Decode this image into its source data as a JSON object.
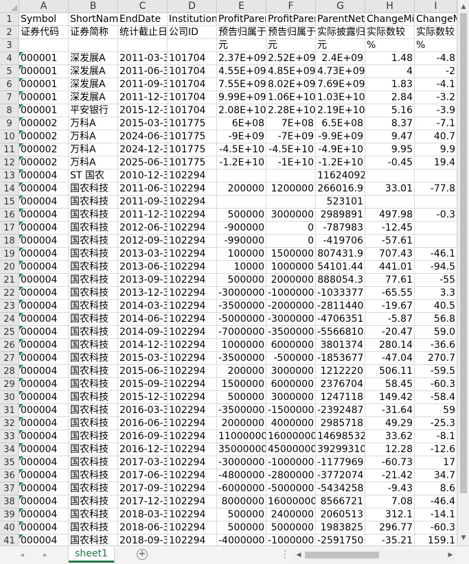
{
  "spreadsheet": {
    "columns": [
      "A",
      "B",
      "C",
      "D",
      "E",
      "F",
      "G",
      "H",
      "I"
    ],
    "column_width_names": [
      "A",
      "B",
      "C",
      "D",
      "E",
      "F",
      "G",
      "H",
      "I"
    ],
    "header_rows": [
      {
        "row": "1",
        "cells": [
          "Symbol",
          "ShortName",
          "EndDate",
          "InstitutionID",
          "ProfitParent",
          "ProfitParent",
          "ParentNetProfit",
          "ChangeMin",
          "ChangeMax"
        ]
      },
      {
        "row": "2",
        "cells": [
          "证券代码",
          "证券简称",
          "统计截止日期",
          "公司ID",
          "预告归属于",
          "预告归属于",
          "实际披露归",
          "实际数较",
          "实际数较"
        ]
      },
      {
        "row": "3",
        "cells": [
          "",
          "",
          "",
          "",
          "元",
          "元",
          "元",
          "%",
          "%"
        ]
      }
    ],
    "data_rows": [
      {
        "row": "4",
        "cells": [
          "000001",
          "深发展A",
          "2011-03-31",
          "101704",
          "2.37E+09",
          "2.52E+09",
          "2.4E+09",
          "1.48",
          "-4.8"
        ]
      },
      {
        "row": "5",
        "cells": [
          "000001",
          "深发展A",
          "2011-06-30",
          "101704",
          "4.55E+09",
          "4.85E+09",
          "4.73E+09",
          "4",
          "-2"
        ]
      },
      {
        "row": "6",
        "cells": [
          "000001",
          "深发展A",
          "2011-09-30",
          "101704",
          "7.55E+09",
          "8.02E+09",
          "7.69E+09",
          "1.83",
          "-4.1"
        ]
      },
      {
        "row": "7",
        "cells": [
          "000001",
          "深发展A",
          "2011-12-31",
          "101704",
          "9.99E+09",
          "1.06E+10",
          "1.03E+10",
          "2.84",
          "-3.2"
        ]
      },
      {
        "row": "8",
        "cells": [
          "000001",
          "平安银行",
          "2015-12-31",
          "101704",
          "2.08E+10",
          "2.28E+10",
          "2.19E+10",
          "5.16",
          "-3.9"
        ]
      },
      {
        "row": "9",
        "cells": [
          "000002",
          "万科A",
          "2015-03-31",
          "101775",
          "6E+08",
          "7E+08",
          "6.5E+08",
          "8.37",
          "-7.1"
        ]
      },
      {
        "row": "10",
        "cells": [
          "000002",
          "万科A",
          "2024-06-30",
          "101775",
          "-9E+09",
          "-7E+09",
          "-9.9E+09",
          "9.47",
          "40.7"
        ]
      },
      {
        "row": "11",
        "cells": [
          "000002",
          "万科A",
          "2024-12-31",
          "101775",
          "-4.5E+10",
          "-4.5E+10",
          "-4.9E+10",
          "9.95",
          "9.9"
        ]
      },
      {
        "row": "12",
        "cells": [
          "000002",
          "万科A",
          "2025-06-30",
          "101775",
          "-1.2E+10",
          "-1E+10",
          "-1.2E+10",
          "-0.45",
          "19.4"
        ]
      },
      {
        "row": "13",
        "cells": [
          "000004",
          "ST 国农",
          "2010-12-31",
          "102294",
          "",
          "",
          "11624092",
          "",
          ""
        ]
      },
      {
        "row": "14",
        "cells": [
          "000004",
          "国农科技",
          "2011-06-30",
          "102294",
          "200000",
          "1200000",
          "266016.9",
          "33.01",
          "-77.8"
        ]
      },
      {
        "row": "15",
        "cells": [
          "000004",
          "国农科技",
          "2011-09-30",
          "102294",
          "",
          "",
          "523101",
          "",
          ""
        ]
      },
      {
        "row": "16",
        "cells": [
          "000004",
          "国农科技",
          "2011-12-31",
          "102294",
          "500000",
          "3000000",
          "2989891",
          "497.98",
          "-0.3"
        ]
      },
      {
        "row": "17",
        "cells": [
          "000004",
          "国农科技",
          "2012-06-30",
          "102294",
          "-900000",
          "0",
          "-787983",
          "-12.45",
          ""
        ]
      },
      {
        "row": "18",
        "cells": [
          "000004",
          "国农科技",
          "2012-09-30",
          "102294",
          "-990000",
          "0",
          "-419706",
          "-57.61",
          ""
        ]
      },
      {
        "row": "19",
        "cells": [
          "000004",
          "国农科技",
          "2013-03-31",
          "102294",
          "100000",
          "1500000",
          "807431.9",
          "707.43",
          "-46.1"
        ]
      },
      {
        "row": "20",
        "cells": [
          "000004",
          "国农科技",
          "2013-06-30",
          "102294",
          "10000",
          "1000000",
          "54101.44",
          "441.01",
          "-94.5"
        ]
      },
      {
        "row": "21",
        "cells": [
          "000004",
          "国农科技",
          "2013-09-30",
          "102294",
          "500000",
          "2000000",
          "888054.3",
          "77.61",
          "-55"
        ]
      },
      {
        "row": "22",
        "cells": [
          "000004",
          "国农科技",
          "2013-12-31",
          "102294",
          "-3000000",
          "-1000000",
          "-1033377",
          "-65.55",
          "3.3"
        ]
      },
      {
        "row": "23",
        "cells": [
          "000004",
          "国农科技",
          "2014-03-31",
          "102294",
          "-3500000",
          "-2000000",
          "-2811440",
          "-19.67",
          "40.5"
        ]
      },
      {
        "row": "24",
        "cells": [
          "000004",
          "国农科技",
          "2014-06-30",
          "102294",
          "-5000000",
          "-3000000",
          "-4706351",
          "-5.87",
          "56.8"
        ]
      },
      {
        "row": "25",
        "cells": [
          "000004",
          "国农科技",
          "2014-09-30",
          "102294",
          "-7000000",
          "-3500000",
          "-5566810",
          "-20.47",
          "59.0"
        ]
      },
      {
        "row": "26",
        "cells": [
          "000004",
          "国农科技",
          "2014-12-31",
          "102294",
          "1000000",
          "6000000",
          "3801374",
          "280.14",
          "-36.6"
        ]
      },
      {
        "row": "27",
        "cells": [
          "000004",
          "国农科技",
          "2015-03-31",
          "102294",
          "-3500000",
          "-500000",
          "-1853677",
          "-47.04",
          "270.7"
        ]
      },
      {
        "row": "28",
        "cells": [
          "000004",
          "国农科技",
          "2015-06-30",
          "102294",
          "200000",
          "3000000",
          "1212220",
          "506.11",
          "-59.5"
        ]
      },
      {
        "row": "29",
        "cells": [
          "000004",
          "国农科技",
          "2015-09-30",
          "102294",
          "1500000",
          "6000000",
          "2376704",
          "58.45",
          "-60.3"
        ]
      },
      {
        "row": "30",
        "cells": [
          "000004",
          "国农科技",
          "2015-12-31",
          "102294",
          "500000",
          "3000000",
          "1247118",
          "149.42",
          "-58.4"
        ]
      },
      {
        "row": "31",
        "cells": [
          "000004",
          "国农科技",
          "2016-03-31",
          "102294",
          "-3500000",
          "-1500000",
          "-2392487",
          "-31.64",
          "59"
        ]
      },
      {
        "row": "32",
        "cells": [
          "000004",
          "国农科技",
          "2016-06-30",
          "102294",
          "2000000",
          "4000000",
          "2985718",
          "49.29",
          "-25.3"
        ]
      },
      {
        "row": "33",
        "cells": [
          "000004",
          "国农科技",
          "2016-09-30",
          "102294",
          "11000000",
          "16000000",
          "14698532",
          "33.62",
          "-8.1"
        ]
      },
      {
        "row": "34",
        "cells": [
          "000004",
          "国农科技",
          "2016-12-31",
          "102294",
          "35000000",
          "45000000",
          "39299310",
          "12.28",
          "-12.6"
        ]
      },
      {
        "row": "35",
        "cells": [
          "000004",
          "国农科技",
          "2017-03-31",
          "102294",
          "-3000000",
          "-1000000",
          "-1177969",
          "-60.73",
          "17"
        ]
      },
      {
        "row": "36",
        "cells": [
          "000004",
          "国农科技",
          "2017-06-30",
          "102294",
          "-4800000",
          "-2800000",
          "-3772074",
          "-21.42",
          "34.7"
        ]
      },
      {
        "row": "37",
        "cells": [
          "000004",
          "国农科技",
          "2017-09-30",
          "102294",
          "-6000000",
          "-5000000",
          "-5434258",
          "-9.43",
          "8.6"
        ]
      },
      {
        "row": "38",
        "cells": [
          "000004",
          "国农科技",
          "2017-12-31",
          "102294",
          "8000000",
          "16000000",
          "8566721",
          "7.08",
          "-46.4"
        ]
      },
      {
        "row": "39",
        "cells": [
          "000004",
          "国农科技",
          "2018-03-31",
          "102294",
          "500000",
          "2400000",
          "2060513",
          "312.1",
          "-14.1"
        ]
      },
      {
        "row": "40",
        "cells": [
          "000004",
          "国农科技",
          "2018-06-30",
          "102294",
          "500000",
          "5000000",
          "1983825",
          "296.77",
          "-60.3"
        ]
      },
      {
        "row": "41",
        "cells": [
          "000004",
          "国农科技",
          "2018-09-30",
          "102294",
          "-4000000",
          "-1000000",
          "-2591750",
          "-35.21",
          "159.1"
        ]
      }
    ]
  },
  "tabs": {
    "active_sheet": "sheet1",
    "add_symbol": "⊕",
    "more_symbol": "⋮"
  },
  "nav": {
    "prev_symbol": "◂",
    "next_symbol": "▸"
  },
  "colors": {
    "accent": "#217346",
    "flag": "#1e8f4e",
    "header_bg": "#e6e6e6",
    "grid": "#d9d9d9"
  }
}
